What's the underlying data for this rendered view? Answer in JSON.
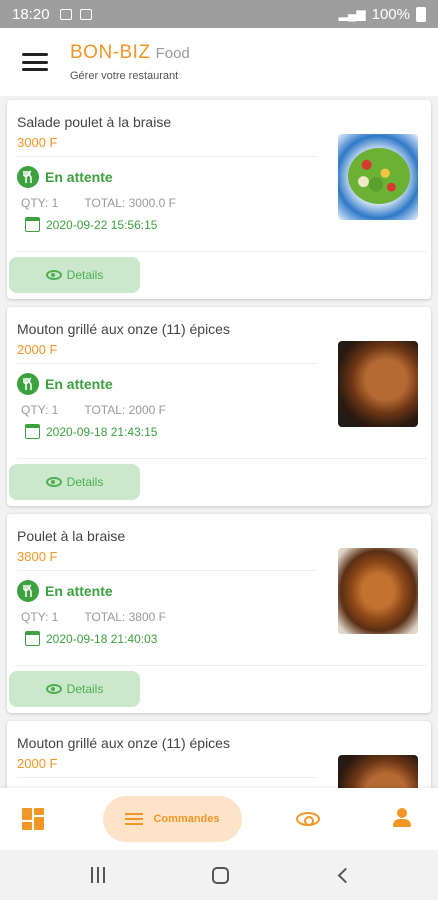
{
  "status_bar": {
    "time": "18:20",
    "battery": "100%"
  },
  "app_bar": {
    "brand_name": "BON-BIZ",
    "brand_suffix": "Food",
    "tagline": "Gérer votre restaurant"
  },
  "orders": [
    {
      "title": "Salade poulet à  la braise",
      "price": "3000 F",
      "status": "En attente",
      "qty": "QTY: 1",
      "total": "TOTAL: 3000.0 F",
      "date": "2020-09-22 15:56:15",
      "details_label": "Details",
      "image": "salad"
    },
    {
      "title": "Mouton grillé aux onze (11) épices",
      "price": "2000 F",
      "status": "En attente",
      "qty": "QTY: 1",
      "total": "TOTAL: 2000 F",
      "date": "2020-09-18 21:43:15",
      "details_label": "Details",
      "image": "mutton"
    },
    {
      "title": "Poulet à  la braise",
      "price": "3800 F",
      "status": "En attente",
      "qty": "QTY: 1",
      "total": "TOTAL: 3800 F",
      "date": "2020-09-18 21:40:03",
      "details_label": "Details",
      "image": "chicken"
    },
    {
      "title": "Mouton grillé aux onze (11) épices",
      "price": "2000 F",
      "status": "",
      "qty": "",
      "total": "",
      "date": "",
      "details_label": "",
      "image": "mutton"
    }
  ],
  "bottom_nav": {
    "items": [
      {
        "icon": "dashboard-icon",
        "label": ""
      },
      {
        "icon": "list-icon",
        "label": "Commandes",
        "active": true
      },
      {
        "icon": "eye-icon",
        "label": ""
      },
      {
        "icon": "user-icon",
        "label": ""
      }
    ]
  },
  "colors": {
    "accent": "#f29625",
    "status_green": "#3da13f",
    "details_bg": "#cbe8cc",
    "nav_active_bg": "#fde3c7"
  }
}
